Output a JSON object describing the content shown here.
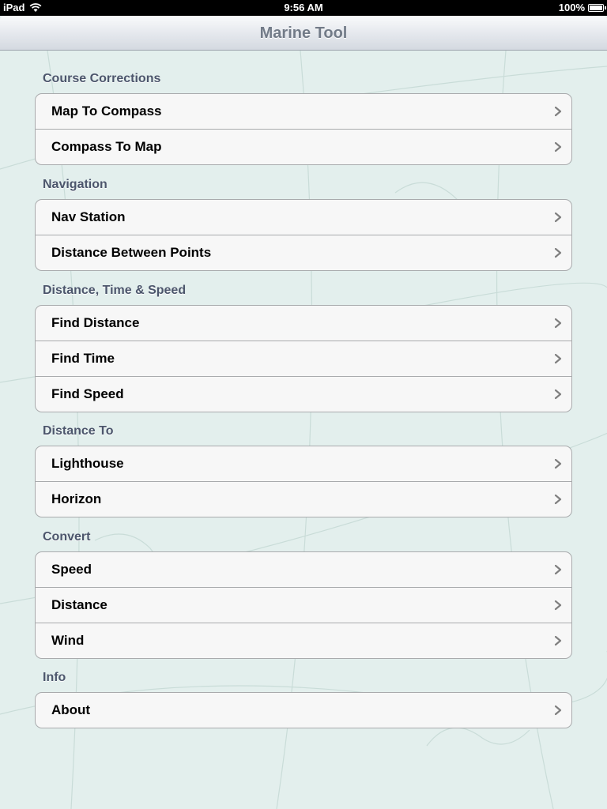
{
  "status_bar": {
    "carrier": "iPad",
    "time": "9:56 AM",
    "battery": "100%"
  },
  "nav": {
    "title": "Marine Tool"
  },
  "sections": [
    {
      "header": "Course Corrections",
      "items": [
        {
          "label": "Map To Compass"
        },
        {
          "label": "Compass To Map"
        }
      ]
    },
    {
      "header": "Navigation",
      "items": [
        {
          "label": "Nav Station"
        },
        {
          "label": "Distance Between Points"
        }
      ]
    },
    {
      "header": "Distance, Time & Speed",
      "items": [
        {
          "label": "Find Distance"
        },
        {
          "label": "Find Time"
        },
        {
          "label": "Find Speed"
        }
      ]
    },
    {
      "header": "Distance To",
      "items": [
        {
          "label": "Lighthouse"
        },
        {
          "label": "Horizon"
        }
      ]
    },
    {
      "header": "Convert",
      "items": [
        {
          "label": "Speed"
        },
        {
          "label": "Distance"
        },
        {
          "label": "Wind"
        }
      ]
    },
    {
      "header": "Info",
      "items": [
        {
          "label": "About"
        }
      ]
    }
  ],
  "icons": {
    "wifi": "wifi-icon",
    "battery": "battery-icon",
    "chevron": "chevron-right-icon"
  },
  "colors": {
    "section_header": "#4c566c",
    "nav_title": "#727b88",
    "background": "#e3efed"
  }
}
